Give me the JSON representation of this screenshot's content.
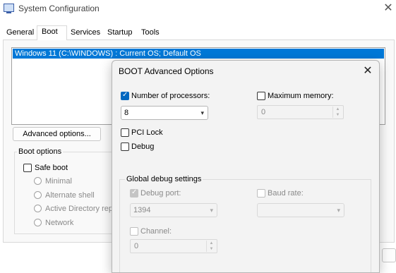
{
  "window": {
    "title": "System Configuration",
    "close_glyph": "✕"
  },
  "tabs": [
    {
      "label": "General"
    },
    {
      "label": "Boot"
    },
    {
      "label": "Services"
    },
    {
      "label": "Startup"
    },
    {
      "label": "Tools"
    }
  ],
  "os_list": {
    "items": [
      "Windows 11 (C:\\WINDOWS) : Current OS; Default OS"
    ]
  },
  "advanced_button": "Advanced options...",
  "boot_options": {
    "label": "Boot options",
    "safe_boot": {
      "label": "Safe boot",
      "checked": false
    },
    "modes": [
      "Minimal",
      "Alternate shell",
      "Active Directory repair",
      "Network"
    ]
  },
  "dialog": {
    "title": "BOOT Advanced Options",
    "close_glyph": "✕",
    "processors": {
      "label": "Number of processors:",
      "checked": true,
      "value": "8"
    },
    "memory": {
      "label": "Maximum memory:",
      "checked": false,
      "value": "0"
    },
    "pci_lock": {
      "label": "PCI Lock",
      "checked": false
    },
    "debug": {
      "label": "Debug",
      "checked": false
    },
    "debug_group": {
      "label": "Global debug settings",
      "debug_port": {
        "label": "Debug port:",
        "checked": true,
        "value": "1394"
      },
      "baud_rate": {
        "label": "Baud rate:",
        "checked": false,
        "value": ""
      },
      "channel": {
        "label": "Channel:",
        "checked": false,
        "value": "0"
      }
    }
  },
  "colors": {
    "selection": "#0078d7",
    "checkbox_accent": "#0067c0"
  },
  "icons": {
    "app": "system-configuration-icon",
    "chevron": "▾",
    "spin_up": "▲",
    "spin_down": "▼"
  }
}
